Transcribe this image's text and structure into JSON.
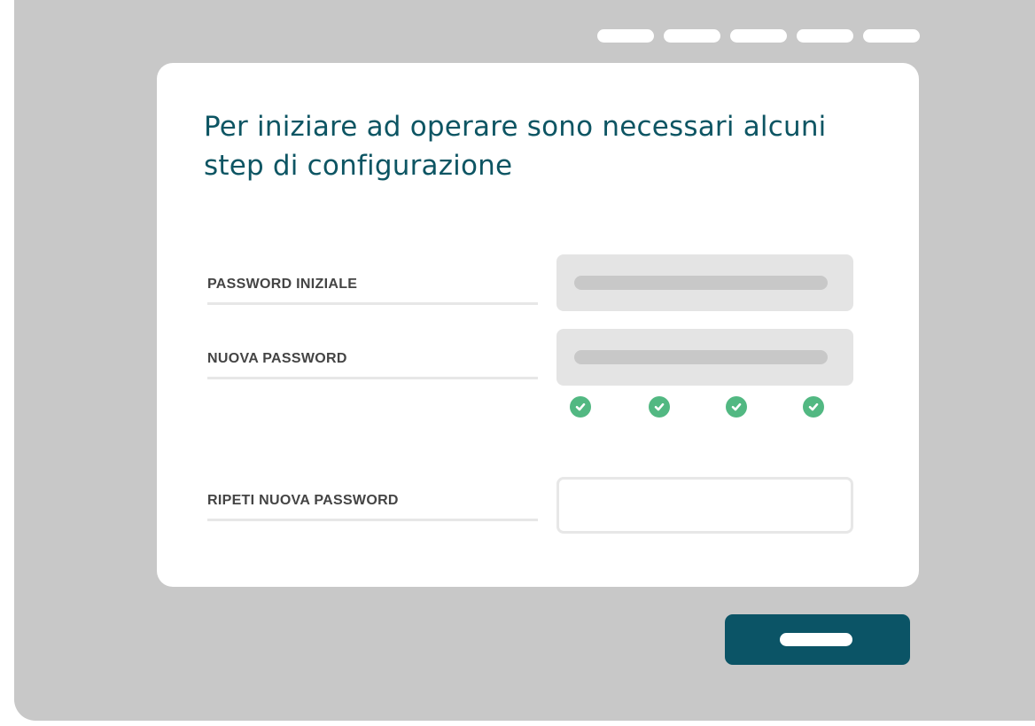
{
  "progress": {
    "total_steps": 5
  },
  "card": {
    "title": "Per iniziare ad operare sono necessari alcuni step di configurazione"
  },
  "form": {
    "initial_password": {
      "label": "PASSWORD INIZIALE",
      "state": "filled"
    },
    "new_password": {
      "label": "NUOVA PASSWORD",
      "state": "filled",
      "requirements_met": 4,
      "requirements_total": 4
    },
    "repeat_password": {
      "label": "RIPETI NUOVA PASSWORD",
      "state": "empty"
    }
  },
  "icons": {
    "requirement": "check-circle-icon"
  },
  "colors": {
    "accent": "#0b5466",
    "title": "#0d5563",
    "success": "#52b882",
    "background": "#c8c8c8"
  }
}
